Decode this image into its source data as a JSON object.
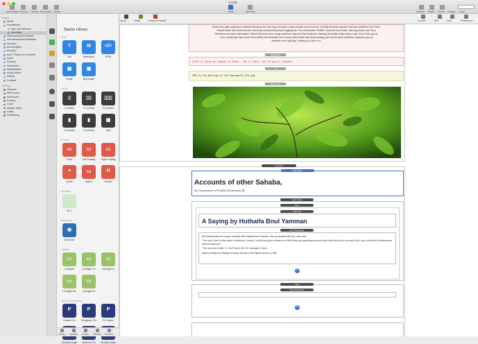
{
  "window": {
    "title": "InvOle"
  },
  "toolbar": {
    "left": [
      "Add Widget",
      "Projects",
      "Themes",
      "Resources",
      "Stacks"
    ],
    "center": [
      "Mode",
      "Simulate"
    ],
    "right": [
      "Address",
      "Health",
      "Home",
      "Publish",
      "Local"
    ]
  },
  "toolbar2": {
    "items": [
      "Library",
      "Partial",
      "External Template"
    ],
    "right_items": [
      "Console",
      "Edit",
      "Lock",
      "Preferences"
    ]
  },
  "sidebar": {
    "pages_header": "Pages",
    "pages": [
      "MAIN",
      "Humanized",
      "Man and Women",
      "Abu Bakr",
      "Recommended Articles",
      "Recommended Websites",
      "test php",
      "test tangible",
      "test.php",
      "test-T-Table-of-Contents",
      "Islam",
      "Society",
      "Seasoned",
      "Metaphysics",
      "Audio Video",
      "Advice",
      "Contact"
    ],
    "settings_header": "Settings",
    "settings": [
      "General",
      "Web Icons",
      "Advanced",
      "Privacy",
      "Code",
      "Master Style",
      "Notes",
      "Publishing"
    ]
  },
  "library": {
    "title": "Stacks Library",
    "sections": [
      {
        "name": "Basic",
        "tiles": [
          {
            "label": "Text",
            "glyph": "T",
            "color": "#2f86e6"
          },
          {
            "label": "Markdown",
            "glyph": "M",
            "color": "#2f86e6"
          },
          {
            "label": "HTML",
            "glyph": "</>",
            "color": "#2f86e6"
          },
          {
            "label": "Image",
            "glyph": "▣",
            "color": "#2f86e6"
          },
          {
            "label": "Bkg Image",
            "glyph": "▣",
            "color": "#2f86e6"
          }
        ]
      },
      {
        "name": "Layout",
        "tiles": [
          {
            "label": "1 Column",
            "glyph": "▯",
            "color": "#3c3c3c"
          },
          {
            "label": "2 Columns",
            "glyph": "▯▯",
            "color": "#3c3c3c"
          },
          {
            "label": "3 Columns",
            "glyph": "▯▯▯",
            "color": "#3c3c3c"
          },
          {
            "label": "4 Columns",
            "glyph": "▮",
            "color": "#3c3c3c"
          },
          {
            "label": "5 Columns",
            "glyph": "▮",
            "color": "#3c3c3c"
          },
          {
            "label": "Grid",
            "glyph": "▦",
            "color": "#3c3c3c"
          }
        ]
      },
      {
        "name": "Controls",
        "tiles": [
          {
            "label": "Float",
            "glyph": "▭",
            "color": "#e05a4a"
          },
          {
            "label": "Left Floating",
            "glyph": "▭",
            "color": "#e05a4a"
          },
          {
            "label": "Right Floating",
            "glyph": "▭",
            "color": "#e05a4a"
          },
          {
            "label": "Quote",
            "glyph": "❝",
            "color": "#e05a4a"
          },
          {
            "label": "Button",
            "glyph": "▭",
            "color": "#e05a4a"
          },
          {
            "label": "Header",
            "glyph": "H",
            "color": "#e05a4a"
          }
        ]
      },
      {
        "name": "Accordion",
        "tiles": [
          {
            "label": "Sy 2",
            "glyph": "◌",
            "color": "#cfe8c8"
          }
        ]
      },
      {
        "name": "Animations",
        "tiles": [
          {
            "label": "Overview",
            "glyph": "◉",
            "color": "#2d6fb6"
          }
        ]
      },
      {
        "name": "Lightbox",
        "tiles": [
          {
            "label": "Limelight",
            "glyph": "▭",
            "color": "#9ac26b"
          },
          {
            "label": "Limelight Ov",
            "glyph": "▭",
            "color": "#9ac26b"
          },
          {
            "label": "Limelight Lo",
            "glyph": "▭",
            "color": "#9ac26b"
          },
          {
            "label": "Limelight Me",
            "glyph": "▭",
            "color": "#9ac26b"
          },
          {
            "label": "Limelight Vo",
            "glyph": "▭",
            "color": "#9ac26b"
          }
        ]
      },
      {
        "name": "Stacks Pro Elements",
        "tiles": [
          {
            "label": "Header Pro",
            "glyph": "P",
            "color": "#2b3a7a"
          },
          {
            "label": "Paragraph Pro",
            "glyph": "P",
            "color": "#2b3a7a"
          },
          {
            "label": "Pro Styles",
            "glyph": "P",
            "color": "#2b3a7a"
          },
          {
            "label": "Sections Angle",
            "glyph": "◆",
            "color": "#2b3a7a"
          },
          {
            "label": "Sections Pro",
            "glyph": "◆",
            "color": "#2b3a7a"
          },
          {
            "label": "Sections Mask",
            "glyph": "◆",
            "color": "#2b3a7a"
          }
        ]
      }
    ],
    "bottom": [
      "Library",
      "Updates",
      "Simple",
      "Window",
      "Populars"
    ]
  },
  "canvas": {
    "lorem_lines": [
      "Gluten-free paleo gastropub authentic flexitarian five tote bag, scenester Cosby sweater irony locavore. Gentrify American Apparel craft beer aesthetic Echo Park,",
      "Pickled Marfa viral dreamcatcher, chambray smocknella quinoa meggings fat. Terry Richardson PBR&B. Sartorial viral crucifix, fixie bug Austin meh Terry",
      "Richardson art party hella blaster Cleese Etsy trust fund, forage craft beer keyboard fixie Anderson Hashtag Shoreditch High-Hanus route. Echo Park pop-up",
      "Lomo messenger bag 3 wolf moon selfies tofu flexitarian Vice occupy. Blue Bottle kale chips hashtag, jean shorts direct semiotics wayfarers pop-up",
      "aesthetic retro bag Etsy Truffaut put a bird on it."
    ],
    "markdown_label": "Markdown",
    "markdown_text": "Ṣifāt-ul Ṣafwa wa Ṭabaqāt-ul Ruwāṭ — Ibn al-Jawzī, Abū Nu'aym al-Iṣfahānī",
    "text_label": "Text",
    "text_value": "IBN_Z1_The-Biology-of-the-Baroque21_S78.jpg",
    "image_label": "Bkg Image",
    "container_label": "Container",
    "markdown2_label": "Markdown",
    "heading": "Accounts of other Sahaba,",
    "subheading": "the Companions of Prophet Muhammad ﷺ",
    "card_stack_label": "Card Stack",
    "card_label": "Card",
    "card_title_label": "Card Title",
    "card_title": "A Saying by Huthaifa Bnul Yamman",
    "card_paragraph_label": "Card Paragraph",
    "card_paragraphs": [
      "Abu Muhammad bin Moyyah narrated that Huthaifa Bnul Yamman, God be pleased with him, once said:",
      "\"The most I fear for this nation of believers (\"umma\"), is that they give preference to What they see (appearances) over what they know (to be true and real\"), and to keep into heedlessness without realizing it.\"",
      "\"True and real is Allah ﷻ, His Prophet ﷺ, the message of Islam.",
      "Hilyat-ul Awliya wa Tabaqat-ul Asfiya, Beauty of the Righteousness, p.298"
    ],
    "card2_label": "Card",
    "card_paragraph2_label": "Card Paragraph"
  }
}
